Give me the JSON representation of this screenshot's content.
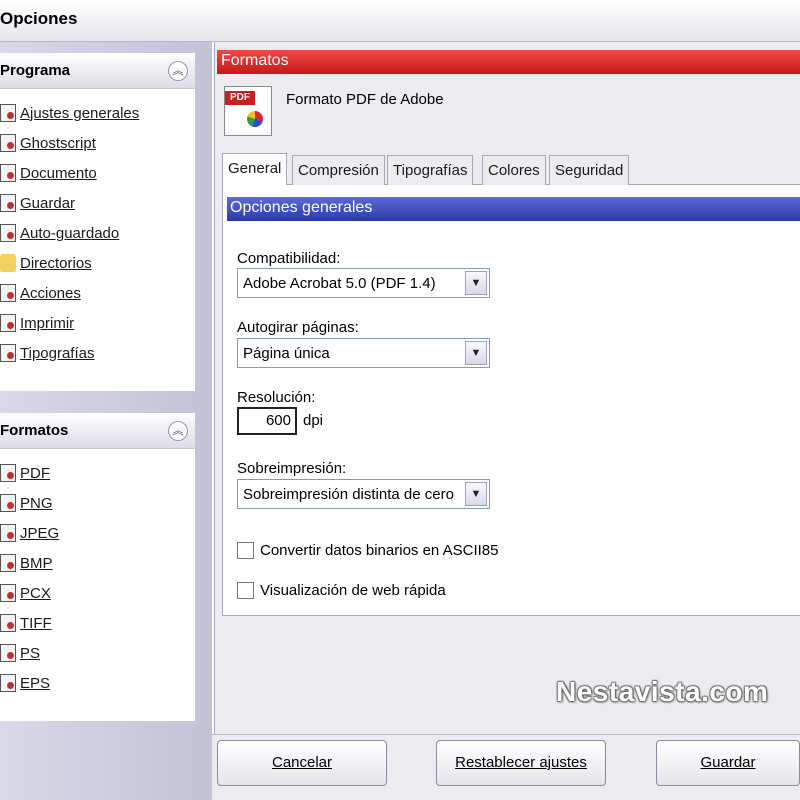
{
  "window": {
    "title": "Opciones"
  },
  "sidebar": {
    "programa": {
      "title": "Programa",
      "items": [
        {
          "label": "Ajustes generales"
        },
        {
          "label": "Ghostscript"
        },
        {
          "label": "Documento"
        },
        {
          "label": "Guardar"
        },
        {
          "label": "Auto-guardado"
        },
        {
          "label": "Directorios"
        },
        {
          "label": "Acciones"
        },
        {
          "label": "Imprimir"
        },
        {
          "label": "Tipografías"
        }
      ]
    },
    "formatos": {
      "title": "Formatos",
      "items": [
        {
          "label": "PDF"
        },
        {
          "label": "PNG"
        },
        {
          "label": "JPEG"
        },
        {
          "label": "BMP"
        },
        {
          "label": "PCX"
        },
        {
          "label": "TIFF"
        },
        {
          "label": "PS"
        },
        {
          "label": "EPS"
        }
      ]
    }
  },
  "main": {
    "section_title": "Formatos",
    "format_icon_tag": "PDF",
    "format_name": "Formato PDF de Adobe",
    "tabs": [
      {
        "label": "General"
      },
      {
        "label": "Compresión"
      },
      {
        "label": "Tipografías"
      },
      {
        "label": "Colores"
      },
      {
        "label": "Seguridad"
      }
    ],
    "options_title": "Opciones generales",
    "compat_label": "Compatibilidad:",
    "compat_value": "Adobe Acrobat 5.0 (PDF 1.4)",
    "autorotate_label": "Autogirar páginas:",
    "autorotate_value": "Página única",
    "resolution_label": "Resolución:",
    "resolution_value": "600",
    "resolution_unit": "dpi",
    "overprint_label": "Sobreimpresión:",
    "overprint_value": "Sobreimpresión distinta de cero",
    "checkbox_ascii85": "Convertir datos binarios en ASCII85",
    "checkbox_fastweb": "Visualización de web rápida"
  },
  "watermark": "Nestavista.com",
  "buttons": {
    "cancel": "Cancelar",
    "reset": "Restablecer ajustes",
    "save": "Guardar"
  }
}
